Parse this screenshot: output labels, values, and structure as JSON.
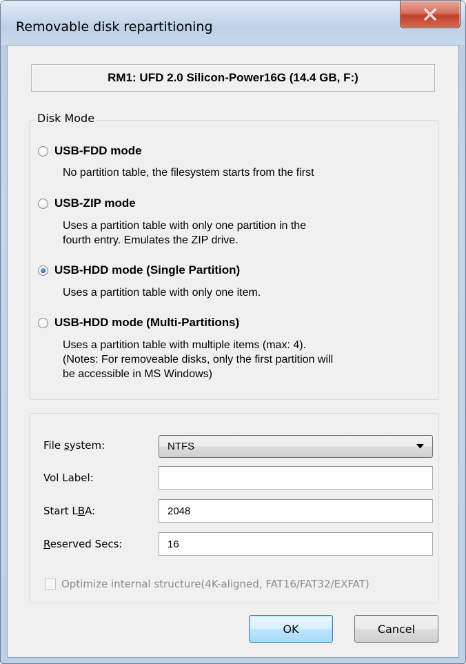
{
  "window": {
    "title": "Removable disk repartitioning",
    "close_glyph": "X"
  },
  "disk": {
    "label": "RM1: UFD 2.0 Silicon-Power16G (14.4 GB, F:)"
  },
  "disk_mode": {
    "legend": "Disk Mode",
    "options": [
      {
        "label": "USB-FDD mode",
        "checked": false,
        "desc": [
          "No partition table, the filesystem starts from the first"
        ]
      },
      {
        "label": "USB-ZIP mode",
        "checked": false,
        "desc": [
          "Uses a partition table with only one partition in the",
          "fourth entry. Emulates the ZIP drive."
        ]
      },
      {
        "label": "USB-HDD mode (Single Partition)",
        "checked": true,
        "desc": [
          "Uses a partition table with only one item."
        ]
      },
      {
        "label": "USB-HDD mode (Multi-Partitions)",
        "checked": false,
        "desc": [
          "Uses a partition table with multiple items (max: 4).",
          "(Notes: For removeable disks, only the first partition will",
          "be accessible in MS Windows)"
        ]
      }
    ]
  },
  "fields": {
    "fs_label_pre": "File ",
    "fs_label_u": "s",
    "fs_label_post": "ystem:",
    "fs_value": "NTFS",
    "vol_label": "Vol Label:",
    "vol_value": "",
    "lba_label_pre": "Start L",
    "lba_label_u": "B",
    "lba_label_post": "A:",
    "lba_value": "2048",
    "res_label_u": "R",
    "res_label_post": "eserved Secs:",
    "res_value": "16",
    "optimize_label": "Optimize internal structure(4K-aligned, FAT16/FAT32/EXFAT)",
    "optimize_checked": false
  },
  "buttons": {
    "ok": "OK",
    "cancel": "Cancel"
  }
}
